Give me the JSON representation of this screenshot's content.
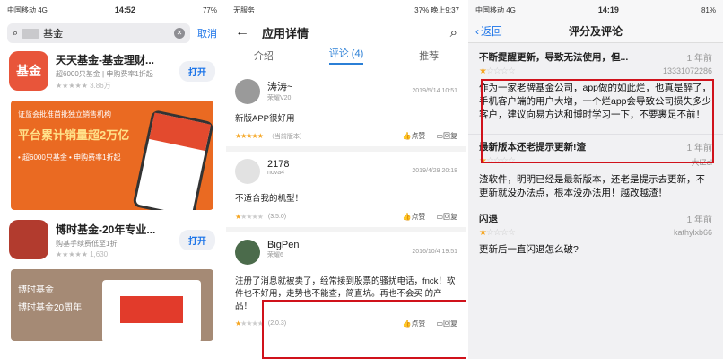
{
  "panel1": {
    "status": {
      "carrier": "中国移动 4G",
      "time": "14:52",
      "battery": "77%"
    },
    "search": {
      "query": "基金",
      "cancel": "取消"
    },
    "apps": [
      {
        "name": "天天基金-基金理财...",
        "sub": "超6000只基金 | 申购费率1折起",
        "rating_count": "3.86万",
        "icon_text": "基金",
        "get": "打开"
      },
      {
        "name": "博时基金-20年专业...",
        "sub": "购基手续费低至1折",
        "rating_count": "1,630",
        "icon_text": "",
        "get": "打开"
      }
    ],
    "banner1": {
      "line1": "证监会批准首批独立销售机构",
      "big": "平台累计销量超2万亿",
      "line2": "• 超6000只基金  • 申购费率1折起"
    },
    "banner2": {
      "line1": "博时基金",
      "line2": "博时基金20周年"
    }
  },
  "panel2": {
    "status": {
      "left": "无服务",
      "battery": "37%",
      "time": "晚上9:37"
    },
    "title": "应用详情",
    "tabs": [
      "介绍",
      "评论 (4)",
      "推荐"
    ],
    "reviews": [
      {
        "name": "涛涛~",
        "device": "荣耀V20",
        "date": "2019/5/14 10:51",
        "body": "新版APP很好用",
        "score": "（当前版本）",
        "like": "点赞",
        "reply": "回复"
      },
      {
        "name": "2178",
        "device": "nova4",
        "date": "2019/4/29 20:18",
        "body": "不适合我的机型！",
        "score": "(3.5.0)",
        "like": "点赞",
        "reply": "回复"
      },
      {
        "name": "BigPen",
        "device": "荣耀6",
        "date": "2016/10/4 19:51",
        "body": "注册了消息就被卖了，经常接到股票的骚扰电话，fnck！软件也不好用，走势也不能查，简直坑。再也不会买      的产品！",
        "score": "(2.0.3)",
        "like": "点赞",
        "reply": "回复"
      }
    ]
  },
  "panel3": {
    "status": {
      "carrier": "中国移动 4G",
      "time": "14:19",
      "battery": "81%"
    },
    "back": "返回",
    "title": "评分及评论",
    "reviews": [
      {
        "title": "不断提醒更新，导致无法使用，但...",
        "ago": "1 年前",
        "user": "13331072286",
        "body": "作为一家老牌基金公司，app做的如此烂，也真是醉了，手机客户端的用户大增，一个烂app会导致公司损失多少客户，建议向易方达和博时学习一下，不要裹足不前！",
        "stars": 1
      },
      {
        "title": "最新版本还老提示更新!渣",
        "ago": "1 年前",
        "user": "大IZcl",
        "body": "渣软件，明明已经是最新版本，还老是提示去更新，不更新就没办法点，根本没办法用！越改越渣！",
        "stars": 1
      },
      {
        "title": "闪退",
        "ago": "1 年前",
        "user": "kathylxb66",
        "body": "更新后一直闪退怎么破?",
        "stars": 1
      }
    ]
  }
}
